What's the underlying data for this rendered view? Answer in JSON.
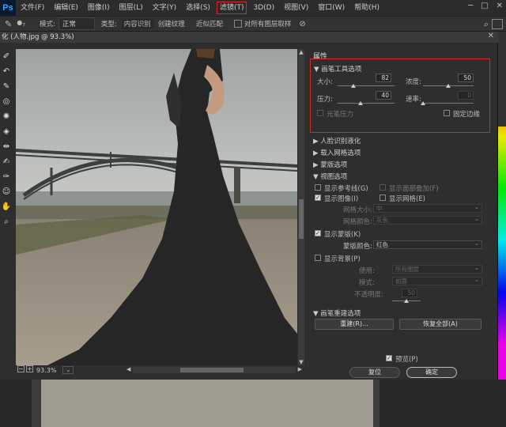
{
  "menubar": {
    "logo": "Ps",
    "items": [
      "文件(F)",
      "编辑(E)",
      "图像(I)",
      "图层(L)",
      "文字(Y)",
      "选择(S)",
      "滤镜(T)",
      "3D(D)",
      "视图(V)",
      "窗口(W)",
      "帮助(H)"
    ],
    "highlighted": "滤镜(T)"
  },
  "optionsbar": {
    "brush_size": "7",
    "mode_label": "模式:",
    "mode_value": "正常",
    "type_label": "类型:",
    "type_content_aware": "内容识别",
    "type_create_texture": "创建纹理",
    "type_proximity": "近似匹配",
    "sample_all_layers": "对所有图层取样"
  },
  "dialog": {
    "title": "化 (人物.jpg @ 93.3%)",
    "zoom": "93.3%"
  },
  "properties": {
    "title": "属性",
    "brush_tool": {
      "heading": "画笔工具选项",
      "size_label": "大小:",
      "size_value": "82",
      "size_fraction": 0.28,
      "density_label": "浓度:",
      "density_value": "50",
      "density_fraction": 0.5,
      "pressure_label": "压力:",
      "pressure_value": "40",
      "pressure_fraction": 0.4,
      "rate_label": "速率:",
      "rate_value": "0",
      "rate_fraction": 0.0,
      "stylus_pressure": "光笔压力",
      "pin_edges": "固定边缘"
    },
    "face_aware": "人脸识别液化",
    "load_mesh": "载入网格选项",
    "mask_options": "蒙版选项",
    "view_options": {
      "heading": "视图选项",
      "show_guides": "显示参考线(G)",
      "show_face_overlay": "显示面部叠加(F)",
      "show_image": "显示图像(I)",
      "show_mesh": "显示网格(E)",
      "mesh_size_label": "网格大小:",
      "mesh_size_value": "中",
      "mesh_color_label": "网格颜色:",
      "mesh_color_value": "灰色"
    },
    "show_mask": {
      "label": "显示蒙版(K)",
      "color_label": "蒙版颜色:",
      "color_value": "红色"
    },
    "show_backdrop": {
      "label": "显示背景(P)",
      "use_label": "使用:",
      "use_value": "所有图层",
      "mode_label": "模式:",
      "mode_value": "前面",
      "opacity_label": "不透明度:",
      "opacity_value": "50",
      "opacity_fraction": 0.5
    },
    "brush_reconstruct": {
      "heading": "画笔重建选项",
      "reconstruct_btn": "重建(R)...",
      "restore_all_btn": "恢复全部(A)"
    },
    "preview_label": "预览(P)",
    "reset_btn": "复位",
    "ok_btn": "确定"
  }
}
